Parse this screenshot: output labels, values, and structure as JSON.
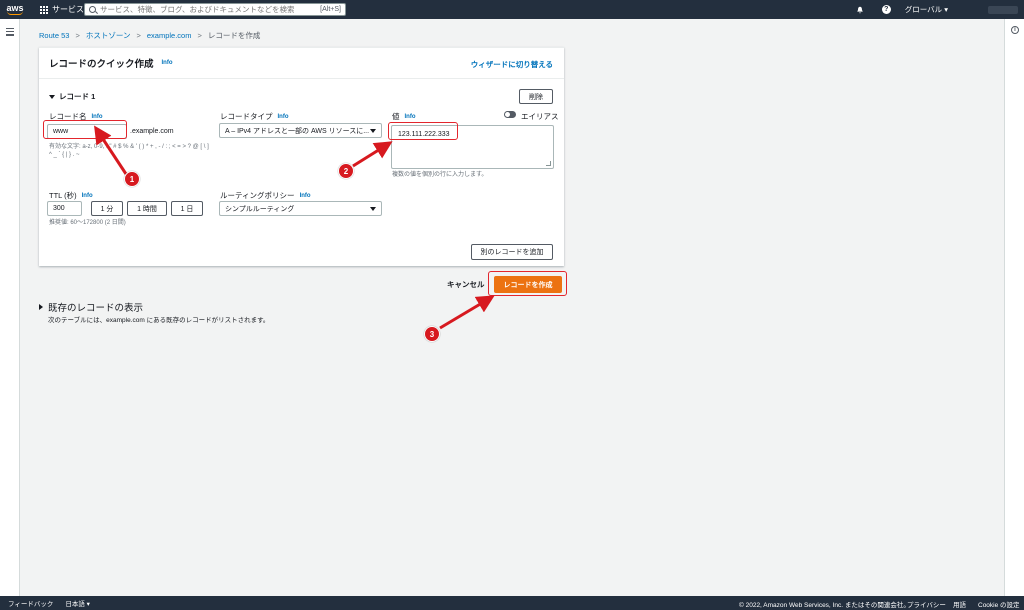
{
  "nav": {
    "logo": "aws",
    "services": "サービス",
    "search_placeholder": "サービス、特徴、ブログ、およびドキュメントなどを検索",
    "search_shortcut": "[Alt+S]",
    "region": "グローバル ▾"
  },
  "breadcrumb": [
    "Route 53",
    "ホストゾーン",
    "example.com",
    "レコードを作成"
  ],
  "panel": {
    "title": "レコードのクイック作成",
    "info": "Info",
    "wizard_link": "ウィザードに切り替える",
    "section_title": "レコード 1",
    "delete_label": "削除",
    "record_name_label": "レコード名",
    "record_name_value": "www",
    "record_name_suffix": ".example.com",
    "record_name_hint": "有効な文字: a-z, 0-9, ! \" # $ % & ' ( ) * + , - / : ; < = > ? @ [ \\ ] ^ _ ` { | } . ~",
    "record_type_label": "レコードタイプ",
    "record_type_value": "A – IPv4 アドレスと一部の AWS リソースに...",
    "value_label": "値",
    "alias_label": "エイリアス",
    "value_input": "123.111.222.333",
    "value_hint": "複数の値を個別の行に入力します。",
    "ttl_label": "TTL (秒)",
    "ttl_value": "300",
    "ttl_buttons": [
      "1 分",
      "1 時間",
      "1 日"
    ],
    "ttl_hint": "推奨値: 60～172800 (2 日間)",
    "routing_label": "ルーティングポリシー",
    "routing_value": "シンプルルーティング",
    "add_record_label": "別のレコードを追加"
  },
  "actions": {
    "cancel": "キャンセル",
    "create": "レコードを作成"
  },
  "existing": {
    "title": "既存のレコードの表示",
    "desc": "次のテーブルには、example.com にある既存のレコードがリストされます。"
  },
  "annotations": [
    "1",
    "2",
    "3"
  ],
  "footer": {
    "feedback": "フィードバック",
    "language": "日本語 ▾",
    "copyright": "© 2022, Amazon Web Services, Inc. またはその関連会社。",
    "privacy": "プライバシー",
    "terms": "用語",
    "cookie": "Cookie の設定"
  },
  "colors": {
    "nav_bg": "#232f3e",
    "primary": "#ec7211",
    "link": "#0073bb",
    "highlight": "#e3262d"
  }
}
